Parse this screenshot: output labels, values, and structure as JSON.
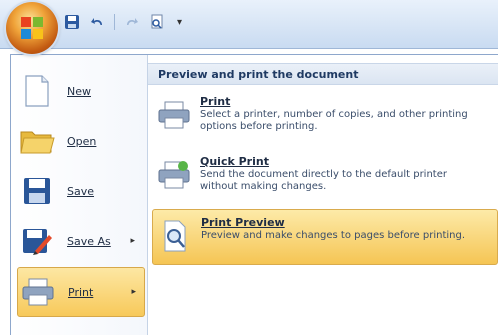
{
  "cropped_text": "ew",
  "left_menu": {
    "items": [
      {
        "label": "New"
      },
      {
        "label": "Open"
      },
      {
        "label": "Save"
      },
      {
        "label": "Save As"
      },
      {
        "label": "Print"
      }
    ]
  },
  "right_pane": {
    "header": "Preview and print the document",
    "options": [
      {
        "title": "Print",
        "desc": "Select a printer, number of copies, and other printing options before printing."
      },
      {
        "title": "Quick Print",
        "desc": "Send the document directly to the default printer without making changes."
      },
      {
        "title": "Print Preview",
        "desc": "Preview and make changes to pages before printing."
      }
    ]
  },
  "colors": {
    "highlight": "#f7c95a",
    "header_text": "#1f3a63",
    "titlebar": "#c9dbf1"
  },
  "icons": [
    "office-logo-icon",
    "save-icon",
    "undo-icon",
    "redo-icon",
    "print-preview-icon",
    "qat-dropdown-icon",
    "new-document-icon",
    "open-folder-icon",
    "save-disk-icon",
    "save-as-icon",
    "printer-icon",
    "quick-print-icon",
    "magnifier-page-icon"
  ]
}
